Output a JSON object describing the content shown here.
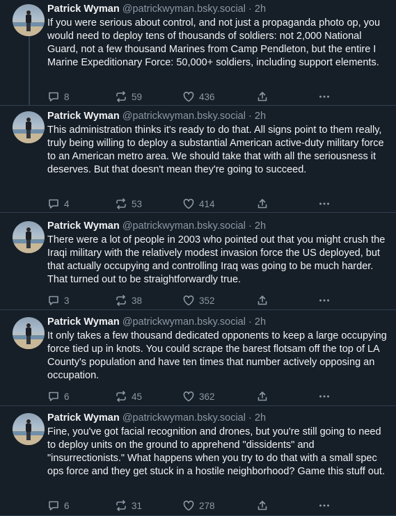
{
  "posts": [
    {
      "author": "Patrick Wyman",
      "handle": "@patrickwyman.bsky.social",
      "time": "2h",
      "text": "If you were serious about control, and not just a propaganda photo op, you would need to deploy tens of thousands of soldiers: not 2,000 National Guard, not a few thousand Marines from Camp Pendleton, but the entire I Marine Expeditionary Force: 50,000+ soldiers, including support elements.",
      "replies": "8",
      "reposts": "59",
      "likes": "436"
    },
    {
      "author": "Patrick Wyman",
      "handle": "@patrickwyman.bsky.social",
      "time": "2h",
      "text": "This administration thinks it's ready to do that. All signs point to them really, truly being willing to deploy a substantial American active-duty military force to an American metro area. We should take that with all the seriousness it deserves. But that doesn't mean they're going to succeed.",
      "replies": "4",
      "reposts": "53",
      "likes": "414"
    },
    {
      "author": "Patrick Wyman",
      "handle": "@patrickwyman.bsky.social",
      "time": "2h",
      "text": "There were a lot of people in 2003 who pointed out that you might crush the Iraqi military with the relatively modest invasion force the US deployed, but that actually occupying and controlling Iraq was going to be much harder. That turned out to be straightforwardly true.",
      "replies": "3",
      "reposts": "38",
      "likes": "352"
    },
    {
      "author": "Patrick Wyman",
      "handle": "@patrickwyman.bsky.social",
      "time": "2h",
      "text": "It only takes a few thousand dedicated opponents to keep a large occupying force tied up in knots. You could scrape the barest flotsam off the top of LA County's population and have ten times that number actively opposing an occupation.",
      "replies": "6",
      "reposts": "45",
      "likes": "362"
    },
    {
      "author": "Patrick Wyman",
      "handle": "@patrickwyman.bsky.social",
      "time": "2h",
      "text": "Fine, you've got facial recognition and drones, but you're still going to need to deploy units on the ground to apprehend \"dissidents\" and \"insurrectionists.\" What happens when you try to do that with a small spec ops force and they get stuck in a hostile neighborhood? Game this stuff out.",
      "replies": "6",
      "reposts": "31",
      "likes": "278"
    }
  ],
  "separator": "·",
  "icons": {
    "reply": "reply-icon",
    "repost": "repost-icon",
    "like": "heart-icon",
    "share": "share-icon",
    "more": "more-icon"
  },
  "colors": {
    "background": "#161e27",
    "border": "#2e4052",
    "text": "#f1f3f5",
    "muted": "#8b98a5"
  }
}
